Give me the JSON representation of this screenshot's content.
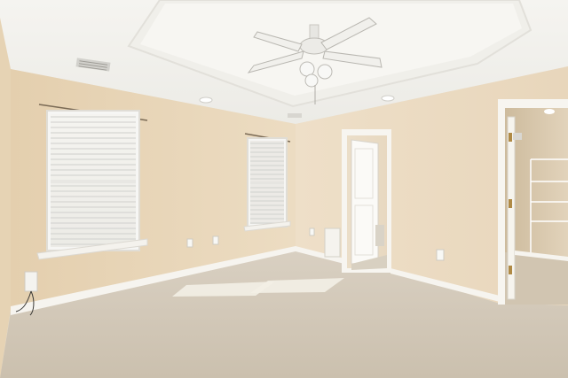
{
  "scene": {
    "kind": "photo-interior",
    "subject": "empty-bedroom",
    "colors": {
      "wall": "#ead9bf",
      "wall_shadow": "#dcc6a6",
      "ceiling": "#f3f1ec",
      "trim": "#f8f6f1",
      "carpet": "#d3c9b9",
      "sunlight": "#f7f3ea",
      "window_glass": "#e6e8e9"
    },
    "icons": [
      "ceiling-fan-icon",
      "window-blinds-icon",
      "door-icon",
      "wire-shelf-icon"
    ]
  }
}
